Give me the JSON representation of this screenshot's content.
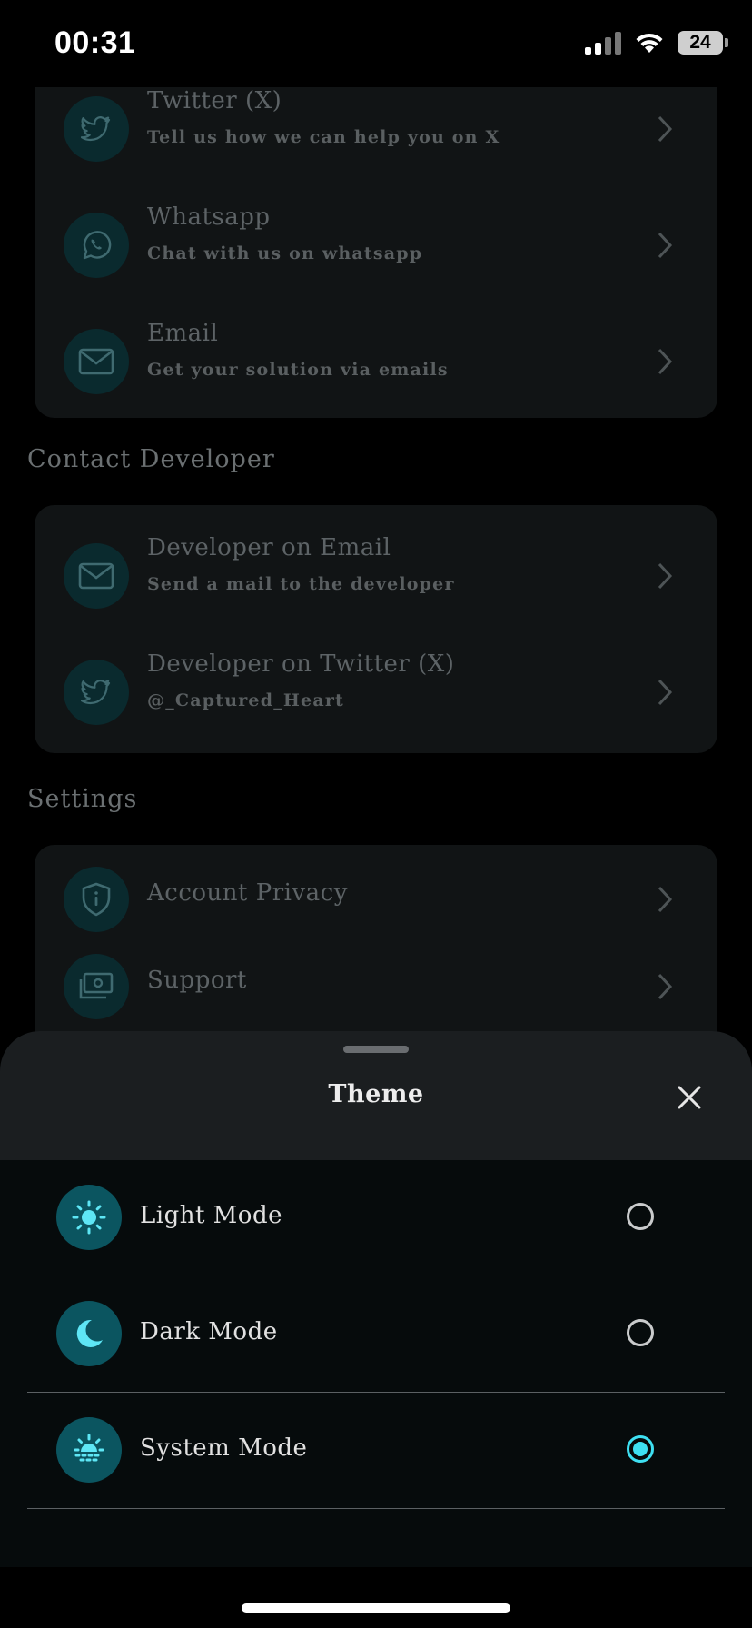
{
  "status_bar": {
    "time": "00:31",
    "battery": "24"
  },
  "support_section": {
    "items": [
      {
        "title": "Twitter (X)",
        "subtitle": "Tell us how we can help you on X",
        "icon": "twitter-bird-icon"
      },
      {
        "title": "Whatsapp",
        "subtitle": "Chat with us on whatsapp",
        "icon": "whatsapp-icon"
      },
      {
        "title": "Email",
        "subtitle": "Get your solution via emails",
        "icon": "mail-icon"
      }
    ]
  },
  "contact_developer": {
    "heading": "Contact Developer",
    "items": [
      {
        "title": "Developer on Email",
        "subtitle": "Send a mail to the developer",
        "icon": "mail-icon"
      },
      {
        "title": "Developer on Twitter (X)",
        "subtitle": "@_Captured_Heart",
        "icon": "twitter-bird-icon"
      }
    ]
  },
  "settings": {
    "heading": "Settings",
    "items": [
      {
        "title": "Account Privacy",
        "icon": "shield-info-icon"
      },
      {
        "title": "Support",
        "icon": "support-icon"
      }
    ]
  },
  "theme_sheet": {
    "title": "Theme",
    "options": [
      {
        "label": "Light Mode",
        "icon": "sun-icon",
        "selected": false
      },
      {
        "label": "Dark Mode",
        "icon": "moon-icon",
        "selected": false
      },
      {
        "label": "System Mode",
        "icon": "sunset-icon",
        "selected": true
      }
    ]
  },
  "colors": {
    "accent": "#3ee0f2",
    "icon_bg": "#0b5560",
    "sheet_bg": "#060b0c"
  }
}
